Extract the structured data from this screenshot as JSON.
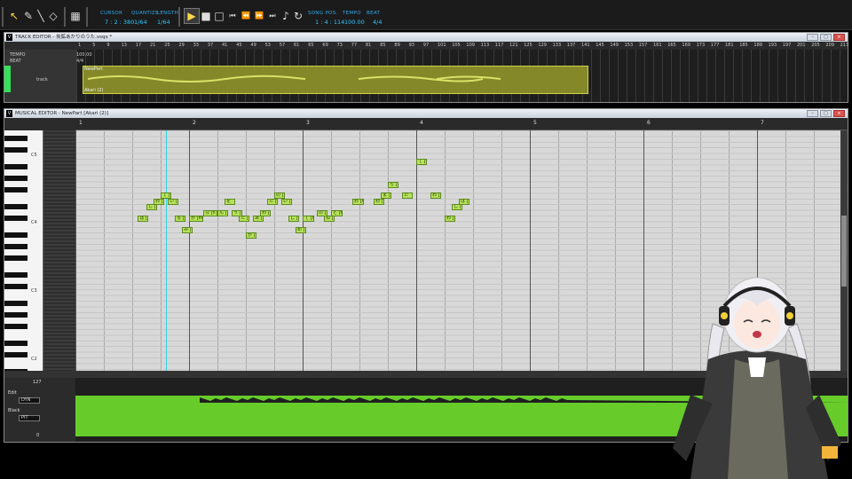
{
  "toolbar": {
    "cursor_label": "CURSOR",
    "cursor_value": "7 : 2 : 380",
    "quantize_label": "QUANTIZE",
    "quantize_value": "1/64",
    "length_label": "LENGTH",
    "length_value": "1/64",
    "songpos_label": "SONG POS.",
    "songpos_value": "1 : 4 : 114",
    "tempo_label": "TEMPO",
    "tempo_value": "100.00",
    "beat_label": "BEAT",
    "beat_value": "4/4"
  },
  "track_editor": {
    "title": "TRACK EDITOR - 炭鉱あかりのうた.vsqx *",
    "tempo_label": "TEMPO",
    "tempo_value": "100.00",
    "beat_label": "BEAT",
    "beat_value": "4/4",
    "track_label": "track",
    "part_name": "NewPart",
    "part_singer": "Akari (2)",
    "ruler": [
      "1",
      "5",
      "9",
      "13",
      "17",
      "21",
      "25",
      "29",
      "33",
      "37",
      "41",
      "45",
      "49",
      "53",
      "57",
      "61",
      "65",
      "69",
      "73",
      "77",
      "81",
      "85",
      "89",
      "93",
      "97",
      "101",
      "105",
      "109",
      "113",
      "117",
      "121",
      "125",
      "129",
      "133",
      "137",
      "141",
      "145",
      "149",
      "153",
      "157",
      "161",
      "165",
      "169",
      "173",
      "177",
      "181",
      "185",
      "189",
      "193",
      "197",
      "201",
      "205",
      "209",
      "213"
    ]
  },
  "musical_editor": {
    "title": "MUSICAL EDITOR - NewPart [Akari (2)]",
    "bars": [
      "1",
      "2",
      "3",
      "4",
      "5",
      "6",
      "7"
    ],
    "key_labels": [
      "C5",
      "C4",
      "C3",
      "C2"
    ],
    "notes": [
      {
        "lyric": "は [",
        "beat": 2.2,
        "len": 0.25,
        "pitch": 61
      },
      {
        "lyric": "し [i]",
        "beat": 2.5,
        "len": 0.25,
        "pitch": 63
      },
      {
        "lyric": "わ [",
        "beat": 2.75,
        "len": 0.25,
        "pitch": 64
      },
      {
        "lyric": "て [t]",
        "beat": 3.0,
        "len": 0.25,
        "pitch": 65
      },
      {
        "lyric": "い [",
        "beat": 3.25,
        "len": 0.25,
        "pitch": 64
      },
      {
        "lyric": "る [t]",
        "beat": 3.5,
        "len": 0.25,
        "pitch": 61
      },
      {
        "lyric": "み [",
        "beat": 3.75,
        "len": 0.25,
        "pitch": 59
      },
      {
        "lyric": "か [m a]",
        "beat": 4.0,
        "len": 0.5,
        "pitch": 61
      },
      {
        "lyric": "な [n a]",
        "beat": 4.5,
        "len": 0.5,
        "pitch": 62
      },
      {
        "lyric": "ん [N]",
        "beat": 5.0,
        "len": 0.25,
        "pitch": 62
      },
      {
        "lyric": "を",
        "beat": 5.25,
        "len": 0.1,
        "pitch": 64
      },
      {
        "lyric": "う [i]",
        "beat": 5.5,
        "len": 0.3,
        "pitch": 62
      },
      {
        "lyric": "た [",
        "beat": 5.75,
        "len": 0.2,
        "pitch": 61
      },
      {
        "lyric": "か [",
        "beat": 6.0,
        "len": 0.2,
        "pitch": 58
      },
      {
        "lyric": "あ [",
        "beat": 6.25,
        "len": 0.2,
        "pitch": 61
      },
      {
        "lyric": "わ [",
        "beat": 6.5,
        "len": 0.2,
        "pitch": 62
      },
      {
        "lyric": "た [t]",
        "beat": 6.75,
        "len": 0.2,
        "pitch": 64
      },
      {
        "lyric": "の [",
        "beat": 7.0,
        "len": 0.2,
        "pitch": 65
      },
      {
        "lyric": "い [",
        "beat": 7.25,
        "len": 0.2,
        "pitch": 64
      },
      {
        "lyric": "し [",
        "beat": 7.5,
        "len": 0.2,
        "pitch": 61
      },
      {
        "lyric": "め [",
        "beat": 7.75,
        "len": 0.2,
        "pitch": 59
      },
      {
        "lyric": "て [m a]",
        "beat": 8.0,
        "len": 0.4,
        "pitch": 61
      },
      {
        "lyric": "の [",
        "beat": 8.5,
        "len": 0.2,
        "pitch": 62
      },
      {
        "lyric": "ね [",
        "beat": 8.75,
        "len": 0.2,
        "pitch": 61
      },
      {
        "lyric": "と [t o]",
        "beat": 9.0,
        "len": 0.4,
        "pitch": 62
      },
      {
        "lyric": "わ [m a]",
        "beat": 9.75,
        "len": 0.4,
        "pitch": 64
      },
      {
        "lyric": "わ [",
        "beat": 10.5,
        "len": 0.2,
        "pitch": 64
      },
      {
        "lyric": "ま [",
        "beat": 10.75,
        "len": 0.2,
        "pitch": 65
      },
      {
        "lyric": "ら [",
        "beat": 11.0,
        "len": 0.3,
        "pitch": 67
      },
      {
        "lyric": "た",
        "beat": 11.5,
        "len": 0.1,
        "pitch": 65
      },
      {
        "lyric": "て [t]",
        "beat": 12.0,
        "len": 0.2,
        "pitch": 71
      },
      {
        "lyric": "わ [",
        "beat": 12.5,
        "len": 0.2,
        "pitch": 65
      },
      {
        "lyric": "わ [",
        "beat": 13.0,
        "len": 0.2,
        "pitch": 61
      },
      {
        "lyric": "し [",
        "beat": 13.25,
        "len": 0.2,
        "pitch": 63
      },
      {
        "lyric": "は [",
        "beat": 13.5,
        "len": 0.2,
        "pitch": 64
      }
    ]
  },
  "param": {
    "max_value": "127",
    "edit_label": "Edit",
    "edit_select": "DYN",
    "black_label": "Black",
    "black_select": "PIT",
    "min_value": "0"
  },
  "icons": [
    "arrow-tool-icon",
    "pencil-tool-icon",
    "line-tool-icon",
    "eraser-tool-icon",
    "grid-tool-icon",
    "play-icon",
    "stop-icon",
    "record-icon",
    "rewind-start-icon",
    "rewind-icon",
    "forward-icon",
    "forward-end-icon",
    "metronome-icon",
    "loop-icon"
  ]
}
